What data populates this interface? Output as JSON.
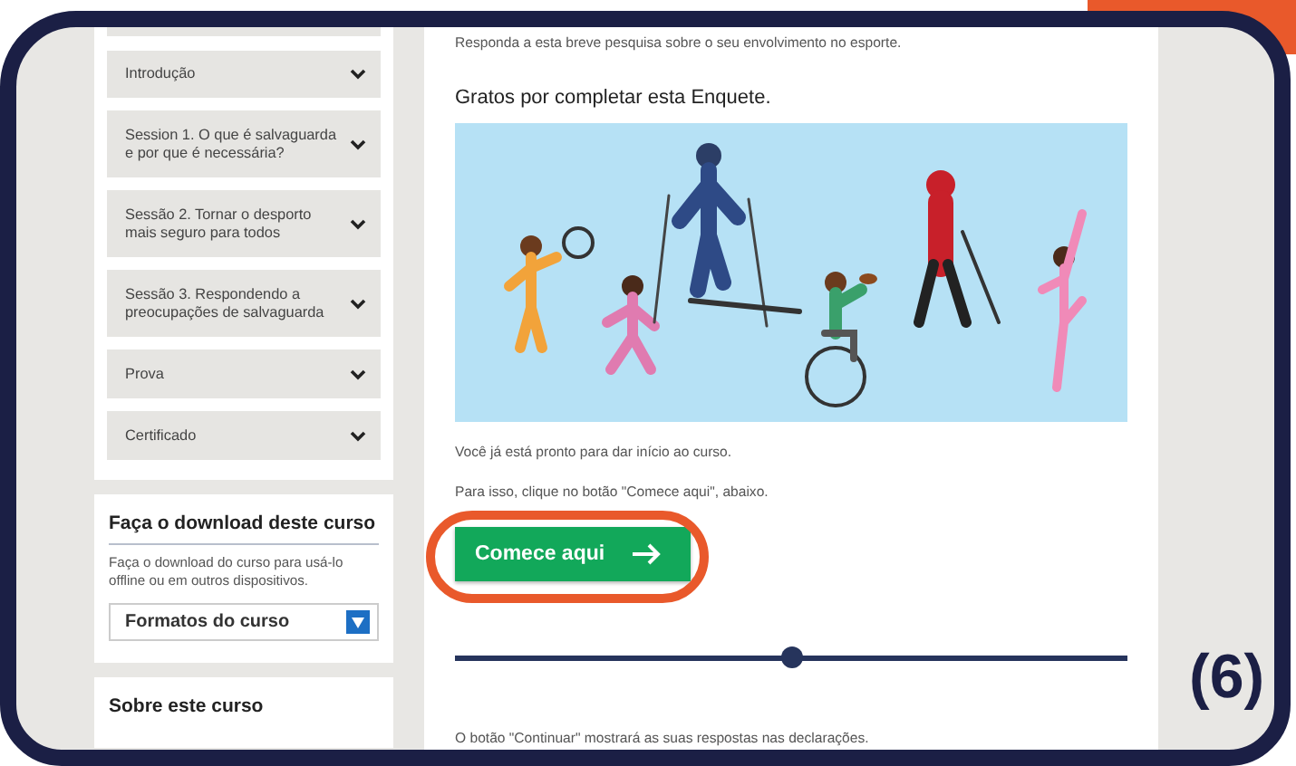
{
  "sidebar": {
    "items": [
      {
        "expanded": false
      },
      {
        "label": "Introdução",
        "expanded": false
      },
      {
        "label": "Session 1. O que é salvaguarda e por que é necessária?",
        "expanded": false
      },
      {
        "label": "Sessão 2. Tornar o desporto mais seguro para todos",
        "expanded": false
      },
      {
        "label": "Sessão 3. Respondendo a preocupações de salvaguarda",
        "expanded": false
      },
      {
        "label": "Prova",
        "expanded": false
      },
      {
        "label": "Certificado",
        "expanded": false
      }
    ]
  },
  "download": {
    "title": "Faça o download deste curso",
    "description": "Faça o download do curso para usá-lo offline ou em outros dispositivos.",
    "select": {
      "value": "Formatos do curso"
    }
  },
  "about": {
    "title": "Sobre este curso"
  },
  "main": {
    "intro": "Responda a esta breve pesquisa sobre o seu envolvimento no esporte.",
    "heading": "Gratos por completar esta Enquete.",
    "ready_text": "Você já está pronto para dar início ao curso.",
    "instruction": "Para isso, clique no botão \"Comece aqui\", abaixo.",
    "button": {
      "label": "Comece aqui",
      "highlighted": true
    },
    "slider": {
      "level": 0.5
    },
    "footer": "O botão \"Continuar\" mostrará as suas respostas nas declarações."
  },
  "annotation": {
    "label": "(6)"
  }
}
